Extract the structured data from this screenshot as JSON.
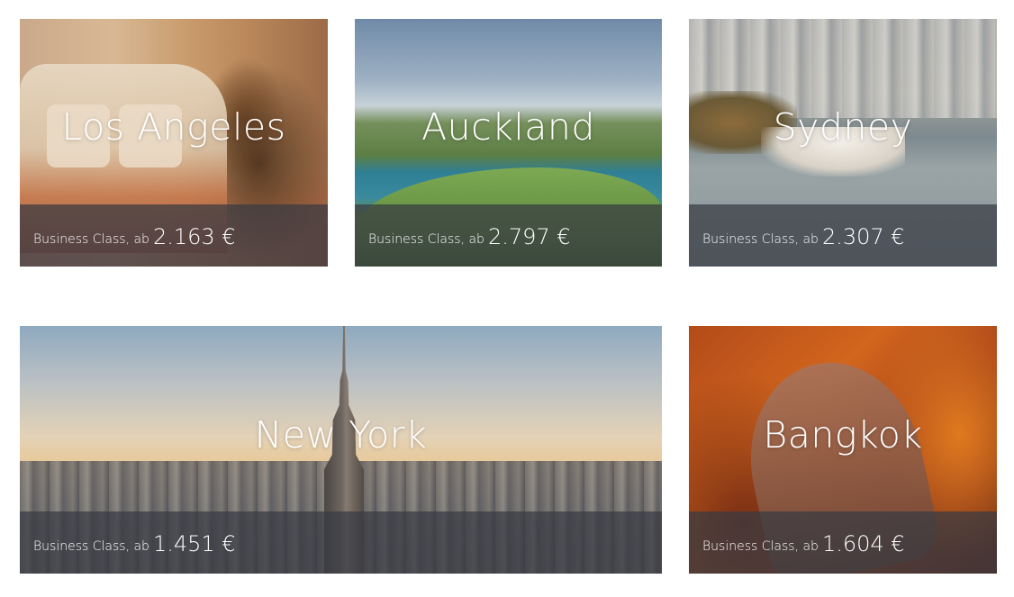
{
  "cards": [
    {
      "city": "Los Angeles",
      "prefix": "Business Class, ab",
      "price": "2.163 €"
    },
    {
      "city": "Auckland",
      "prefix": "Business Class, ab",
      "price": "2.797 €"
    },
    {
      "city": "Sydney",
      "prefix": "Business Class, ab",
      "price": "2.307 €"
    },
    {
      "city": "New York",
      "prefix": "Business Class, ab",
      "price": "1.451 €"
    },
    {
      "city": "Bangkok",
      "prefix": "Business Class, ab",
      "price": "1.604 €"
    }
  ],
  "colors": {
    "overlay_bar": "#373a42",
    "text": "#ffffff"
  }
}
